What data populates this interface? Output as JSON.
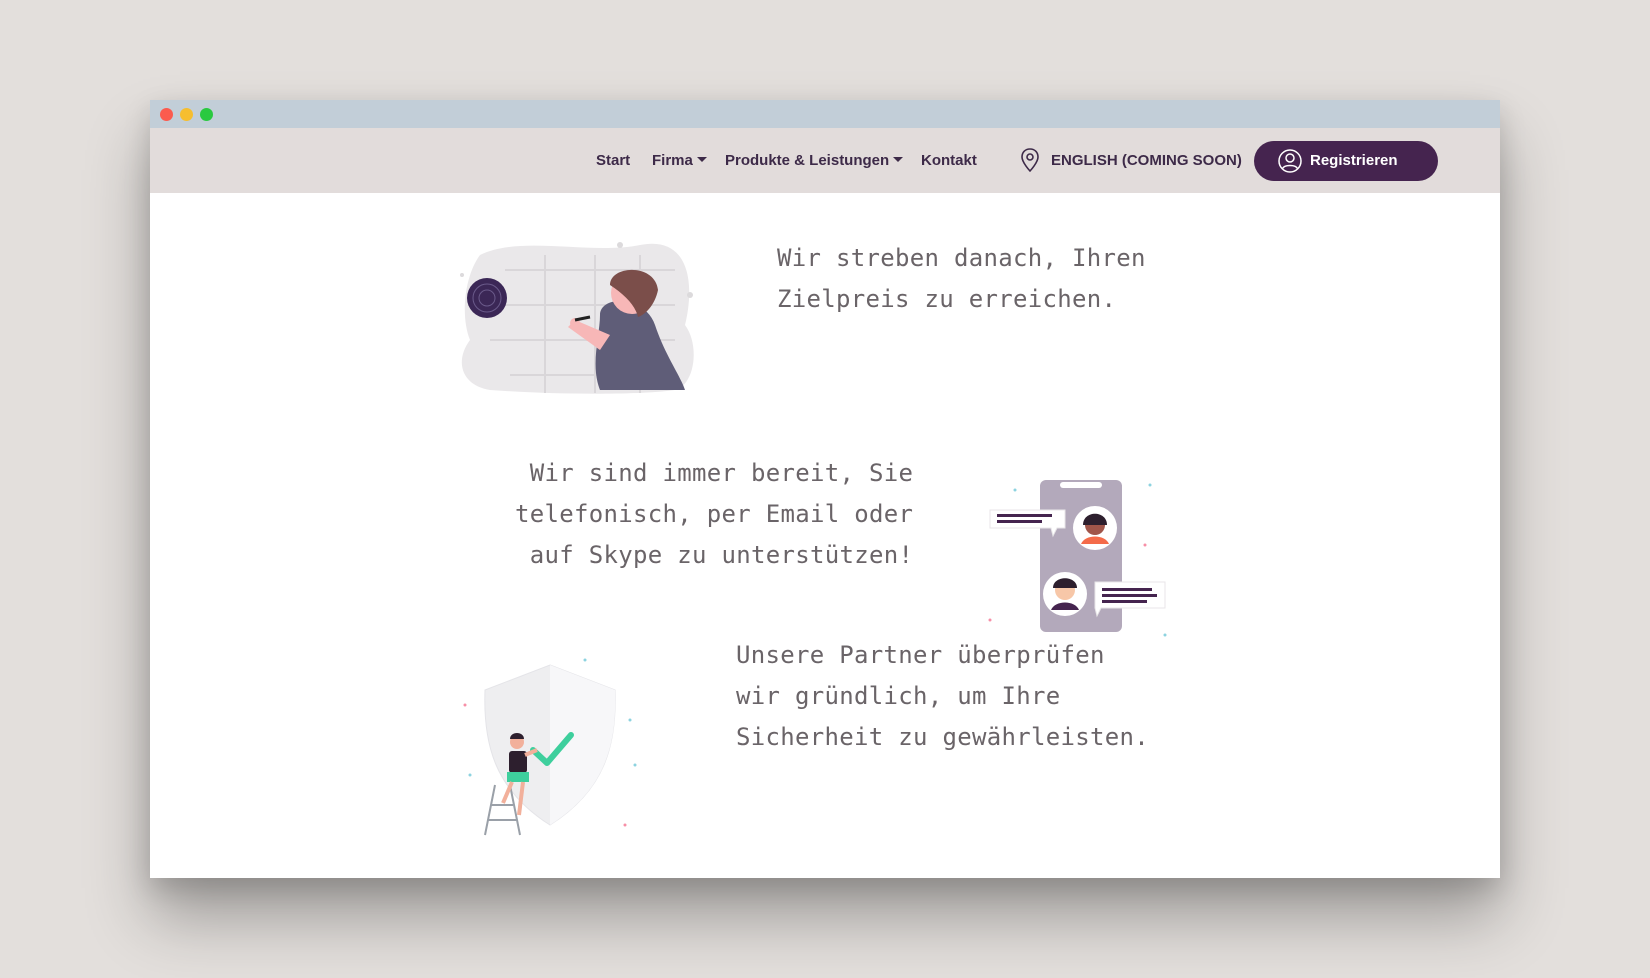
{
  "window": {
    "controls": [
      "close",
      "minimize",
      "maximize"
    ],
    "colors": {
      "close": "#fb5b4e",
      "minimize": "#f6be2f",
      "maximize": "#2ac940"
    }
  },
  "nav": {
    "start": "Start",
    "firma": "Firma",
    "produkte": "Produkte & Leistungen",
    "kontakt": "Kontakt",
    "language": "ENGLISH (COMING SOON)",
    "location_icon": "map-pin-icon",
    "register": "Registrieren",
    "register_icon": "user-circle-icon"
  },
  "features": [
    {
      "text": "Wir streben danach, Ihren\nZielpreis zu erreichen.",
      "illustration": "dart-target-illustration"
    },
    {
      "text": "Wir sind immer bereit, Sie\ntelefonisch, per Email oder\nauf Skype zu unterstützen!",
      "illustration": "phone-chat-illustration"
    },
    {
      "text": "Unsere Partner überprüfen\nwir gründlich, um Ihre\nSicherheit zu gewährleisten.",
      "illustration": "security-shield-illustration"
    }
  ],
  "colors": {
    "brand": "#45244f",
    "nav_bg": "#e2dcdb",
    "titlebar": "#c2ced8",
    "text": "#6a6468",
    "accent_green": "#3ecf9d"
  }
}
